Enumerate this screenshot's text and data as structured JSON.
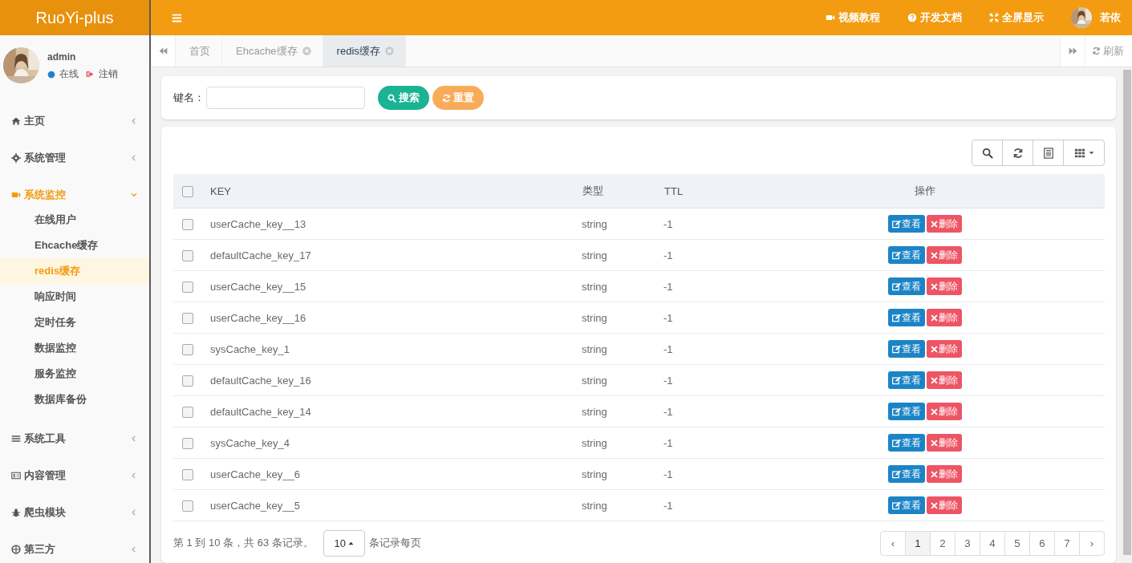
{
  "app": {
    "logo": "RuoYi-plus"
  },
  "header": {
    "links": [
      {
        "kind": "video",
        "label": "视频教程"
      },
      {
        "kind": "help",
        "label": "开发文档"
      },
      {
        "kind": "fullscreen",
        "label": "全屏显示"
      }
    ],
    "user": "若依"
  },
  "user_panel": {
    "name": "admin",
    "status": "在线",
    "logout": "注销"
  },
  "sidebar": {
    "items": [
      {
        "kind": "home",
        "label": "主页",
        "expanded": false,
        "selected": false
      },
      {
        "kind": "gear",
        "label": "系统管理",
        "expanded": false,
        "selected": false
      },
      {
        "kind": "video",
        "label": "系统监控",
        "expanded": true,
        "selected": true,
        "children": [
          {
            "label": "在线用户",
            "selected": false
          },
          {
            "label": "Ehcache缓存",
            "selected": false
          },
          {
            "label": "redis缓存",
            "selected": true
          },
          {
            "label": "响应时间",
            "selected": false
          },
          {
            "label": "定时任务",
            "selected": false
          },
          {
            "label": "数据监控",
            "selected": false
          },
          {
            "label": "服务监控",
            "selected": false
          },
          {
            "label": "数据库备份",
            "selected": false
          }
        ]
      },
      {
        "kind": "bars",
        "label": "系统工具",
        "expanded": false,
        "selected": false
      },
      {
        "kind": "card",
        "label": "内容管理",
        "expanded": false,
        "selected": false
      },
      {
        "kind": "bug",
        "label": "爬虫模块",
        "expanded": false,
        "selected": false
      },
      {
        "kind": "globe",
        "label": "第三方",
        "expanded": false,
        "selected": false
      }
    ]
  },
  "tabs": [
    {
      "label": "首页",
      "selected": false,
      "closable": false
    },
    {
      "label": "Ehcache缓存",
      "selected": false,
      "closable": true
    },
    {
      "label": "redis缓存",
      "selected": true,
      "closable": true
    }
  ],
  "refresh": "刷新",
  "search": {
    "label": "键名：",
    "search_button": "搜索",
    "reset_button": "重置"
  },
  "table": {
    "all_checked": false,
    "columns": [
      "KEY",
      "类型",
      "TTL",
      "操作"
    ],
    "rows": [
      {
        "key": "userCache_key__13",
        "type": "string",
        "ttl": "-1",
        "checked": false,
        "view": "查看",
        "delete": "删除"
      },
      {
        "key": "defaultCache_key_17",
        "type": "string",
        "ttl": "-1",
        "checked": false,
        "view": "查看",
        "delete": "删除"
      },
      {
        "key": "userCache_key__15",
        "type": "string",
        "ttl": "-1",
        "checked": false,
        "view": "查看",
        "delete": "删除"
      },
      {
        "key": "userCache_key__16",
        "type": "string",
        "ttl": "-1",
        "checked": false,
        "view": "查看",
        "delete": "删除"
      },
      {
        "key": "sysCache_key_1",
        "type": "string",
        "ttl": "-1",
        "checked": false,
        "view": "查看",
        "delete": "删除"
      },
      {
        "key": "defaultCache_key_16",
        "type": "string",
        "ttl": "-1",
        "checked": false,
        "view": "查看",
        "delete": "删除"
      },
      {
        "key": "defaultCache_key_14",
        "type": "string",
        "ttl": "-1",
        "checked": false,
        "view": "查看",
        "delete": "删除"
      },
      {
        "key": "sysCache_key_4",
        "type": "string",
        "ttl": "-1",
        "checked": false,
        "view": "查看",
        "delete": "删除"
      },
      {
        "key": "userCache_key__6",
        "type": "string",
        "ttl": "-1",
        "checked": false,
        "view": "查看",
        "delete": "删除"
      },
      {
        "key": "userCache_key__5",
        "type": "string",
        "ttl": "-1",
        "checked": false,
        "view": "查看",
        "delete": "删除"
      }
    ]
  },
  "pagination": {
    "summary": "第 1 到 10 条，共 63 条记录。",
    "page_size": "10",
    "page_size_label": "条记录每页",
    "prev": "‹",
    "next": "›",
    "pages": [
      {
        "label": "1",
        "selected": true
      },
      {
        "label": "2",
        "selected": false
      },
      {
        "label": "3",
        "selected": false
      },
      {
        "label": "4",
        "selected": false
      },
      {
        "label": "5",
        "selected": false
      },
      {
        "label": "6",
        "selected": false
      },
      {
        "label": "7",
        "selected": false
      }
    ]
  }
}
